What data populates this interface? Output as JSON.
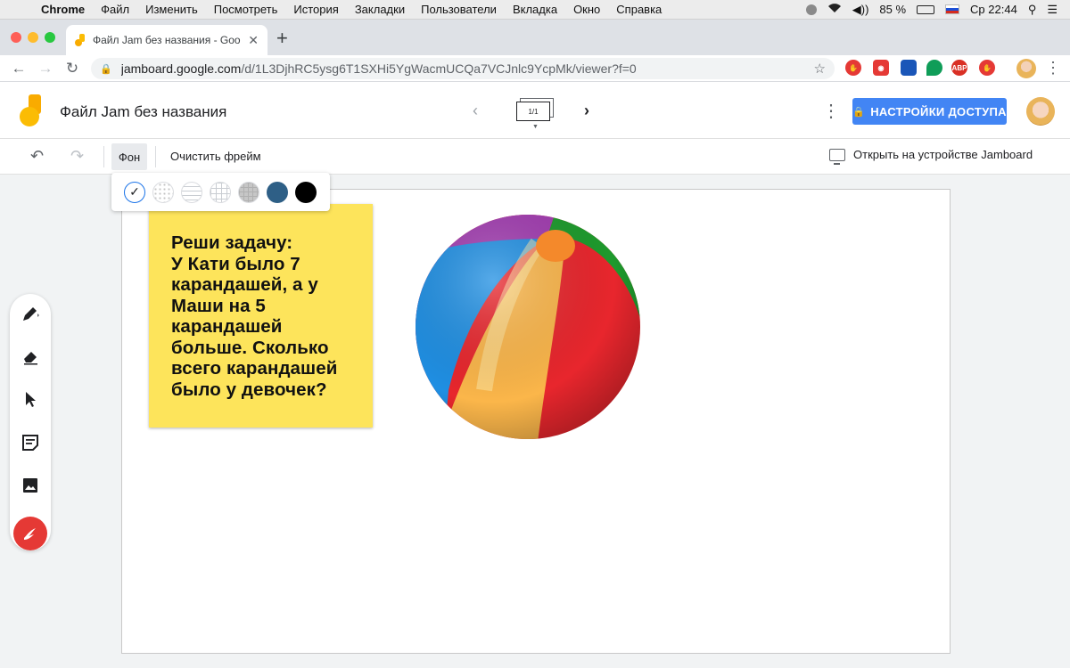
{
  "os_menubar": {
    "app": "Chrome",
    "items": [
      "Файл",
      "Изменить",
      "Посмотреть",
      "История",
      "Закладки",
      "Пользователи",
      "Вкладка",
      "Окно",
      "Справка"
    ],
    "battery": "85 %",
    "clock": "Ср 22:44"
  },
  "browser": {
    "tab_title": "Файл Jam без названия - Goo",
    "url_host": "jamboard.google.com",
    "url_path": "/d/1L3DjhRC5ysg6T1SXHi5YgWacmUCQa7VCJnlc9YcpMk/viewer?f=0",
    "extensions": [
      {
        "name": "red-stop-extension",
        "color": "#e53935",
        "label": "✋"
      },
      {
        "name": "red-record-extension",
        "color": "#e53935",
        "label": "◉"
      },
      {
        "name": "blue-extension",
        "color": "#1a56b8",
        "label": ""
      },
      {
        "name": "green-extension",
        "color": "#0f9d58",
        "label": ""
      },
      {
        "name": "adblock-extension",
        "color": "#d93025",
        "label": "ABP"
      },
      {
        "name": "red-hand-extension",
        "color": "#e53935",
        "label": "✋"
      }
    ]
  },
  "header": {
    "doc_title": "Файл Jam без названия",
    "frame_counter": "1/1",
    "share_label": "НАСТРОЙКИ ДОСТУПА"
  },
  "toolbar": {
    "background_label": "Фон",
    "clear_label": "Очистить фрейм",
    "open_device_label": "Открыть на устройстве Jamboard"
  },
  "background_picker": {
    "options": [
      "plain",
      "dots",
      "lines",
      "grid",
      "gray-grid",
      "blue",
      "black"
    ],
    "selected": "plain",
    "colors": {
      "blue": "#2e5f86",
      "black": "#000000"
    }
  },
  "tools": [
    "pen-icon",
    "eraser-icon",
    "select-icon",
    "sticky-note-icon",
    "image-icon",
    "laser-icon"
  ],
  "canvas": {
    "sticky_note": {
      "color": "#fde45b",
      "text": "Реши задачу:\nУ Кати было 7 карандашей, а у Маши на 5 карандашей больше. Сколько всего карандашей было у девочек?"
    }
  },
  "colors": {
    "accent": "#4285f4",
    "laser": "#e53935"
  }
}
